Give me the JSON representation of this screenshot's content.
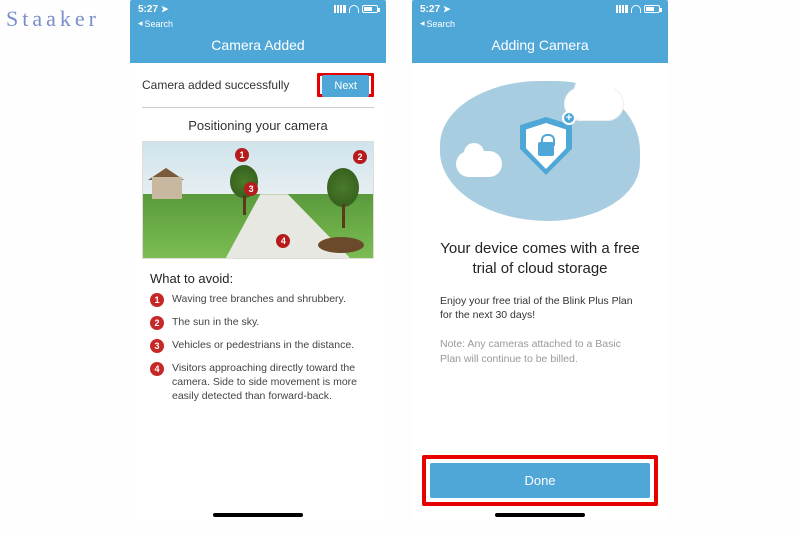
{
  "watermark": "Staaker",
  "status": {
    "time": "5:27",
    "back_label": "Search"
  },
  "phone1": {
    "title": "Camera Added",
    "success_text": "Camera added successfully",
    "next_label": "Next",
    "section_title": "Positioning your camera",
    "avoid_title": "What to avoid:",
    "markers": {
      "m1": "1",
      "m2": "2",
      "m3": "3",
      "m4": "4"
    },
    "avoid_items": [
      {
        "n": "1",
        "text": "Waving tree branches and shrubbery."
      },
      {
        "n": "2",
        "text": "The sun in the sky."
      },
      {
        "n": "3",
        "text": "Vehicles or pedestrians in the distance."
      },
      {
        "n": "4",
        "text": "Visitors approaching directly toward the camera. Side to side movement is more easily detected than forward-back."
      }
    ]
  },
  "phone2": {
    "title": "Adding Camera",
    "plus": "+",
    "heading": "Your device comes with a free trial of cloud storage",
    "body": "Enjoy your free trial of the Blink Plus Plan for the next 30 days!",
    "note": "Note: Any cameras attached to a Basic Plan will continue to be billed.",
    "done_label": "Done"
  }
}
